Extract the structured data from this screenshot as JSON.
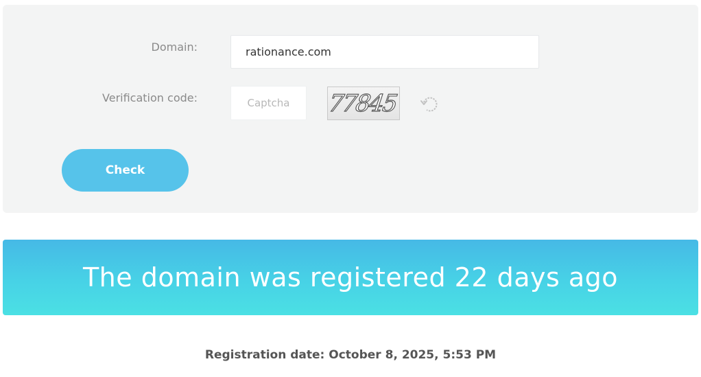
{
  "form": {
    "domain_label": "Domain:",
    "domain_value": "rationance.com",
    "verification_label": "Verification code:",
    "captcha_placeholder": "Captcha",
    "captcha_text": "77845",
    "check_label": "Check"
  },
  "icons": {
    "refresh": "refresh-icon"
  },
  "result": {
    "message": "The domain was registered 22 days ago",
    "registration_date": "Registration date: October 8, 2025, 5:53 PM"
  },
  "colors": {
    "button": "#56c3ea",
    "banner_top": "#46b9e6",
    "banner_bottom": "#4be0e4",
    "panel": "#f3f4f4"
  }
}
